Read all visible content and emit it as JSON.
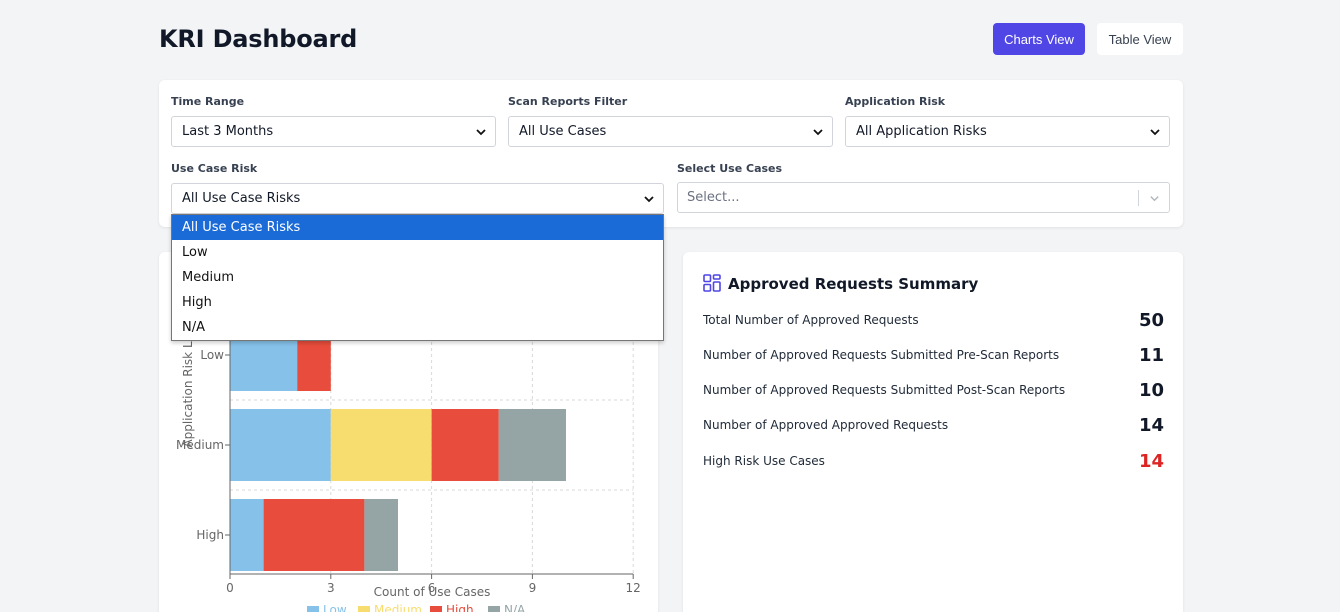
{
  "header": {
    "title": "KRI Dashboard",
    "charts_view_label": "Charts View",
    "table_view_label": "Table View",
    "accent_color": "#4f46e5"
  },
  "filters": {
    "time_range": {
      "label": "Time Range",
      "value": "Last 3 Months"
    },
    "scan_reports": {
      "label": "Scan Reports Filter",
      "value": "All Use Cases"
    },
    "application_risk": {
      "label": "Application Risk",
      "value": "All Application Risks"
    },
    "use_case_risk": {
      "label": "Use Case Risk",
      "value": "All Use Case Risks",
      "options": [
        "All Use Case Risks",
        "Low",
        "Medium",
        "High",
        "N/A"
      ],
      "selected_index": 0
    },
    "select_use_cases": {
      "label": "Select Use Cases",
      "placeholder": "Select..."
    }
  },
  "chart_data": {
    "type": "bar",
    "orientation": "horizontal",
    "stacked": true,
    "categories": [
      "Low",
      "Medium",
      "High"
    ],
    "series": [
      {
        "name": "Low",
        "color": "#85c1e9",
        "values": [
          2,
          3,
          1
        ]
      },
      {
        "name": "Medium",
        "color": "#f7dc6f",
        "values": [
          0,
          3,
          0
        ]
      },
      {
        "name": "High",
        "color": "#e74c3c",
        "values": [
          1,
          2,
          3
        ]
      },
      {
        "name": "N/A",
        "color": "#95a5a6",
        "values": [
          0,
          2,
          1
        ]
      }
    ],
    "xlabel": "Count of Use Cases",
    "ylabel": "Application Risk Level",
    "xlim": [
      0,
      12
    ],
    "xticks": [
      0,
      3,
      6,
      9,
      12
    ],
    "grid": true,
    "legend": "bottom"
  },
  "summary": {
    "title": "Approved Requests Summary",
    "rows": [
      {
        "label": "Total Number of Approved Requests",
        "value": "50"
      },
      {
        "label": "Number of Approved Requests Submitted Pre-Scan Reports",
        "value": "11"
      },
      {
        "label": "Number of Approved Requests Submitted Post-Scan Reports",
        "value": "10"
      },
      {
        "label": "Number of Approved Approved Requests",
        "value": "14"
      },
      {
        "label": "High Risk Use Cases",
        "value": "14",
        "color": "#dc2626"
      }
    ]
  }
}
